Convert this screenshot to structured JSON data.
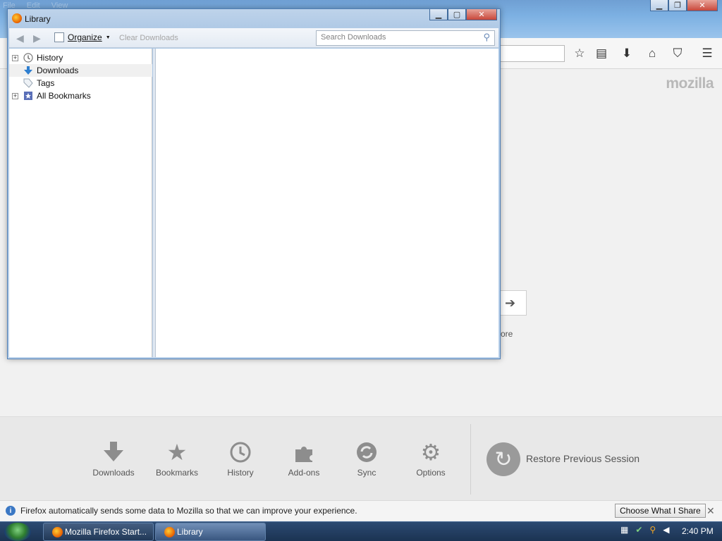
{
  "firefox": {
    "menu": [
      "File",
      "Edit",
      "View"
    ],
    "brand": "mozilla",
    "more_link": "more",
    "launcher": [
      {
        "label": "Downloads",
        "icon": "download-icon"
      },
      {
        "label": "Bookmarks",
        "icon": "star-icon"
      },
      {
        "label": "History",
        "icon": "clock-icon"
      },
      {
        "label": "Add-ons",
        "icon": "puzzle-icon"
      },
      {
        "label": "Sync",
        "icon": "sync-icon"
      },
      {
        "label": "Options",
        "icon": "gear-icon"
      }
    ],
    "restore_label": "Restore Previous Session",
    "notification": {
      "text": "Firefox automatically sends some data to Mozilla so that we can improve your experience.",
      "button": "Choose What I Share"
    }
  },
  "library": {
    "title": "Library",
    "toolbar": {
      "organize_label": "Organize",
      "clear_downloads_label": "Clear Downloads",
      "search_placeholder": "Search Downloads"
    },
    "tree": [
      {
        "label": "History",
        "icon": "clock-icon",
        "expandable": true
      },
      {
        "label": "Downloads",
        "icon": "download-icon",
        "expandable": false,
        "selected": true
      },
      {
        "label": "Tags",
        "icon": "tag-icon",
        "expandable": false
      },
      {
        "label": "All Bookmarks",
        "icon": "bookmarks-icon",
        "expandable": true
      }
    ]
  },
  "taskbar": {
    "items": [
      {
        "label": "Mozilla Firefox Start..."
      },
      {
        "label": "Library"
      }
    ],
    "clock": "2:40 PM"
  },
  "colors": {
    "accent": "#3b78c4",
    "launcher_icon": "#8d8d8d"
  }
}
